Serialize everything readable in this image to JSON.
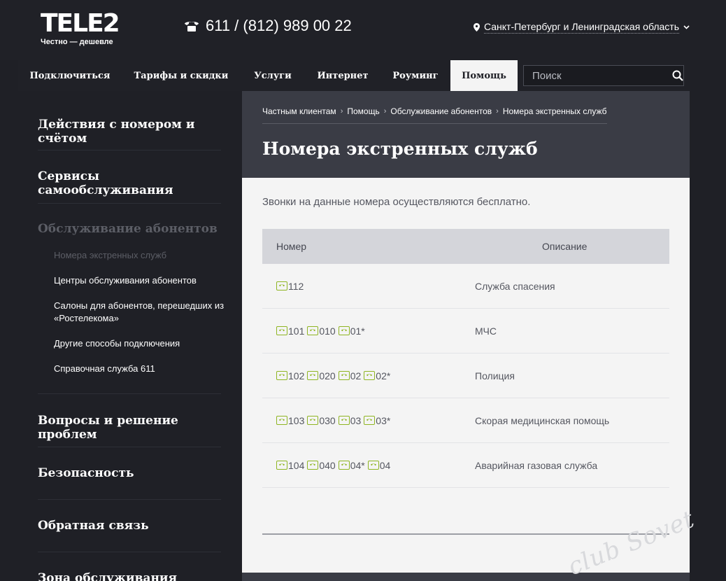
{
  "header": {
    "logo": "TELE2",
    "slogan": "Честно — дешевле",
    "phone": "611 / (812) 989 00 22",
    "region": "Санкт-Петербург и Ленинградская область"
  },
  "nav": {
    "items": [
      "Подключиться",
      "Тарифы и скидки",
      "Услуги",
      "Интернет",
      "Роуминг",
      "Помощь"
    ],
    "active": "Помощь",
    "search_placeholder": "Поиск"
  },
  "sidebar": {
    "sections": [
      "Действия с номером и счётом",
      "Сервисы самообслуживания",
      "Обслуживание абонентов",
      "Вопросы и решение проблем",
      "Безопасность",
      "Обратная связь",
      "Зона обслуживания"
    ],
    "subitems": [
      "Номера экстренных служб",
      "Центры обслуживания абонентов",
      "Салоны для абонентов, перешедших из «Ростелекома»",
      "Другие способы подключения",
      "Справочная служба 611"
    ]
  },
  "main": {
    "breadcrumbs": [
      "Частным клиентам",
      "Помощь",
      "Обслуживание абонентов",
      "Номера экстренных служб"
    ],
    "title": "Номера экстренных служб",
    "intro": "Звонки на данные номера осуществляются бесплатно.",
    "table": {
      "headers": [
        "Номер",
        "Описание"
      ],
      "rows": [
        {
          "numbers": [
            "112"
          ],
          "desc": "Служба спасения"
        },
        {
          "numbers": [
            "101",
            "010",
            "01*"
          ],
          "desc": "МЧС"
        },
        {
          "numbers": [
            "102",
            "020",
            "02",
            "02*"
          ],
          "desc": "Полиция"
        },
        {
          "numbers": [
            "103",
            "030",
            "03",
            "03*"
          ],
          "desc": "Скорая медицинская помощь"
        },
        {
          "numbers": [
            "104",
            "040",
            "04*",
            "04"
          ],
          "desc": "Аварийная газовая служба"
        }
      ]
    }
  },
  "watermark": "club Sovet",
  "colors": {
    "accent_green": "#8fb522",
    "header_dark": "#202127",
    "title_bar": "#3a3c45"
  }
}
